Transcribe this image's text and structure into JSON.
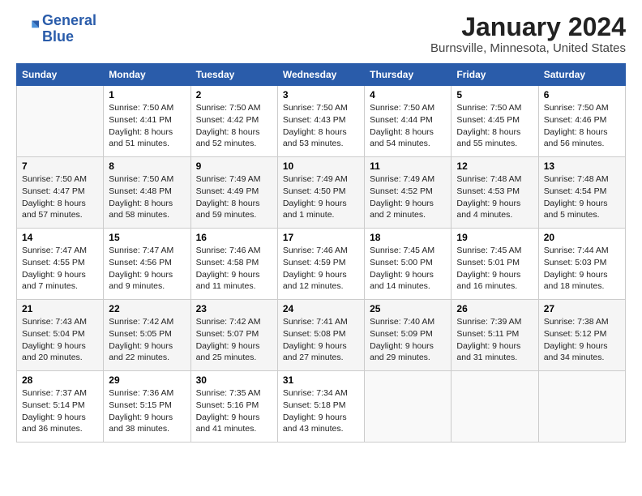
{
  "header": {
    "logo_line1": "General",
    "logo_line2": "Blue",
    "month": "January 2024",
    "location": "Burnsville, Minnesota, United States"
  },
  "days_of_week": [
    "Sunday",
    "Monday",
    "Tuesday",
    "Wednesday",
    "Thursday",
    "Friday",
    "Saturday"
  ],
  "weeks": [
    [
      {
        "day": "",
        "content": ""
      },
      {
        "day": "1",
        "content": "Sunrise: 7:50 AM\nSunset: 4:41 PM\nDaylight: 8 hours\nand 51 minutes."
      },
      {
        "day": "2",
        "content": "Sunrise: 7:50 AM\nSunset: 4:42 PM\nDaylight: 8 hours\nand 52 minutes."
      },
      {
        "day": "3",
        "content": "Sunrise: 7:50 AM\nSunset: 4:43 PM\nDaylight: 8 hours\nand 53 minutes."
      },
      {
        "day": "4",
        "content": "Sunrise: 7:50 AM\nSunset: 4:44 PM\nDaylight: 8 hours\nand 54 minutes."
      },
      {
        "day": "5",
        "content": "Sunrise: 7:50 AM\nSunset: 4:45 PM\nDaylight: 8 hours\nand 55 minutes."
      },
      {
        "day": "6",
        "content": "Sunrise: 7:50 AM\nSunset: 4:46 PM\nDaylight: 8 hours\nand 56 minutes."
      }
    ],
    [
      {
        "day": "7",
        "content": "Sunrise: 7:50 AM\nSunset: 4:47 PM\nDaylight: 8 hours\nand 57 minutes."
      },
      {
        "day": "8",
        "content": "Sunrise: 7:50 AM\nSunset: 4:48 PM\nDaylight: 8 hours\nand 58 minutes."
      },
      {
        "day": "9",
        "content": "Sunrise: 7:49 AM\nSunset: 4:49 PM\nDaylight: 8 hours\nand 59 minutes."
      },
      {
        "day": "10",
        "content": "Sunrise: 7:49 AM\nSunset: 4:50 PM\nDaylight: 9 hours\nand 1 minute."
      },
      {
        "day": "11",
        "content": "Sunrise: 7:49 AM\nSunset: 4:52 PM\nDaylight: 9 hours\nand 2 minutes."
      },
      {
        "day": "12",
        "content": "Sunrise: 7:48 AM\nSunset: 4:53 PM\nDaylight: 9 hours\nand 4 minutes."
      },
      {
        "day": "13",
        "content": "Sunrise: 7:48 AM\nSunset: 4:54 PM\nDaylight: 9 hours\nand 5 minutes."
      }
    ],
    [
      {
        "day": "14",
        "content": "Sunrise: 7:47 AM\nSunset: 4:55 PM\nDaylight: 9 hours\nand 7 minutes."
      },
      {
        "day": "15",
        "content": "Sunrise: 7:47 AM\nSunset: 4:56 PM\nDaylight: 9 hours\nand 9 minutes."
      },
      {
        "day": "16",
        "content": "Sunrise: 7:46 AM\nSunset: 4:58 PM\nDaylight: 9 hours\nand 11 minutes."
      },
      {
        "day": "17",
        "content": "Sunrise: 7:46 AM\nSunset: 4:59 PM\nDaylight: 9 hours\nand 12 minutes."
      },
      {
        "day": "18",
        "content": "Sunrise: 7:45 AM\nSunset: 5:00 PM\nDaylight: 9 hours\nand 14 minutes."
      },
      {
        "day": "19",
        "content": "Sunrise: 7:45 AM\nSunset: 5:01 PM\nDaylight: 9 hours\nand 16 minutes."
      },
      {
        "day": "20",
        "content": "Sunrise: 7:44 AM\nSunset: 5:03 PM\nDaylight: 9 hours\nand 18 minutes."
      }
    ],
    [
      {
        "day": "21",
        "content": "Sunrise: 7:43 AM\nSunset: 5:04 PM\nDaylight: 9 hours\nand 20 minutes."
      },
      {
        "day": "22",
        "content": "Sunrise: 7:42 AM\nSunset: 5:05 PM\nDaylight: 9 hours\nand 22 minutes."
      },
      {
        "day": "23",
        "content": "Sunrise: 7:42 AM\nSunset: 5:07 PM\nDaylight: 9 hours\nand 25 minutes."
      },
      {
        "day": "24",
        "content": "Sunrise: 7:41 AM\nSunset: 5:08 PM\nDaylight: 9 hours\nand 27 minutes."
      },
      {
        "day": "25",
        "content": "Sunrise: 7:40 AM\nSunset: 5:09 PM\nDaylight: 9 hours\nand 29 minutes."
      },
      {
        "day": "26",
        "content": "Sunrise: 7:39 AM\nSunset: 5:11 PM\nDaylight: 9 hours\nand 31 minutes."
      },
      {
        "day": "27",
        "content": "Sunrise: 7:38 AM\nSunset: 5:12 PM\nDaylight: 9 hours\nand 34 minutes."
      }
    ],
    [
      {
        "day": "28",
        "content": "Sunrise: 7:37 AM\nSunset: 5:14 PM\nDaylight: 9 hours\nand 36 minutes."
      },
      {
        "day": "29",
        "content": "Sunrise: 7:36 AM\nSunset: 5:15 PM\nDaylight: 9 hours\nand 38 minutes."
      },
      {
        "day": "30",
        "content": "Sunrise: 7:35 AM\nSunset: 5:16 PM\nDaylight: 9 hours\nand 41 minutes."
      },
      {
        "day": "31",
        "content": "Sunrise: 7:34 AM\nSunset: 5:18 PM\nDaylight: 9 hours\nand 43 minutes."
      },
      {
        "day": "",
        "content": ""
      },
      {
        "day": "",
        "content": ""
      },
      {
        "day": "",
        "content": ""
      }
    ]
  ]
}
